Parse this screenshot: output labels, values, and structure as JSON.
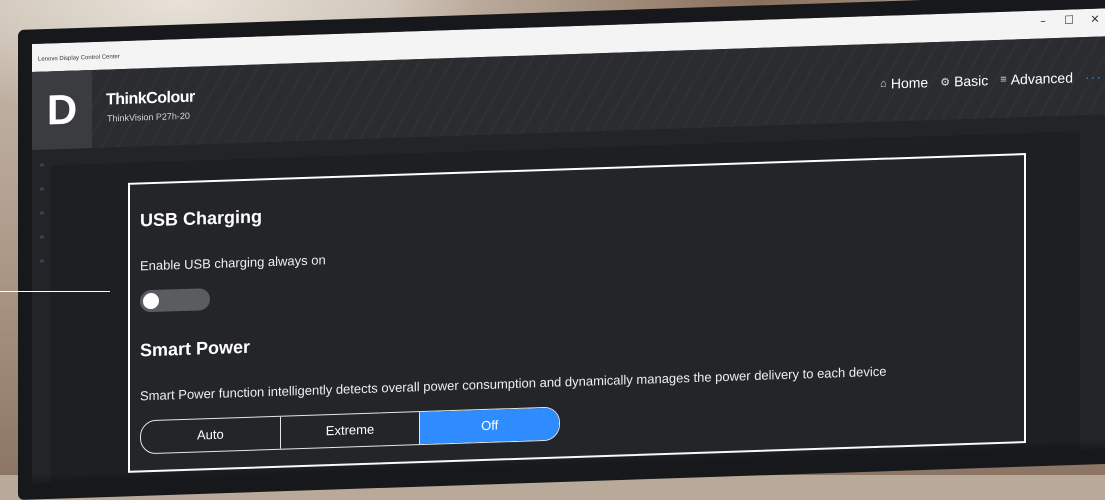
{
  "window": {
    "app_title": "Lenovo Display Control Center",
    "minimize": "–",
    "maximize": "☐",
    "close": "✕"
  },
  "header": {
    "logo_letter": "D",
    "brand": "ThinkColour",
    "model": "ThinkVision P27h-20"
  },
  "nav": {
    "home": "Home",
    "basic": "Basic",
    "advanced": "Advanced",
    "more": "···",
    "icons": {
      "home": "home-icon",
      "basic": "settings-icon",
      "advanced": "sliders-icon"
    }
  },
  "usb": {
    "title": "USB Charging",
    "description": "Enable USB charging always on",
    "toggle_on": false
  },
  "smart_power": {
    "title": "Smart Power",
    "description": "Smart Power function intelligently detects overall power consumption and dynamically manages the power delivery to each device",
    "options": [
      "Auto",
      "Extreme",
      "Off"
    ],
    "selected": "Off"
  },
  "colors": {
    "accent": "#2f8cff",
    "panel_border": "#ffffff",
    "background": "#222427"
  }
}
